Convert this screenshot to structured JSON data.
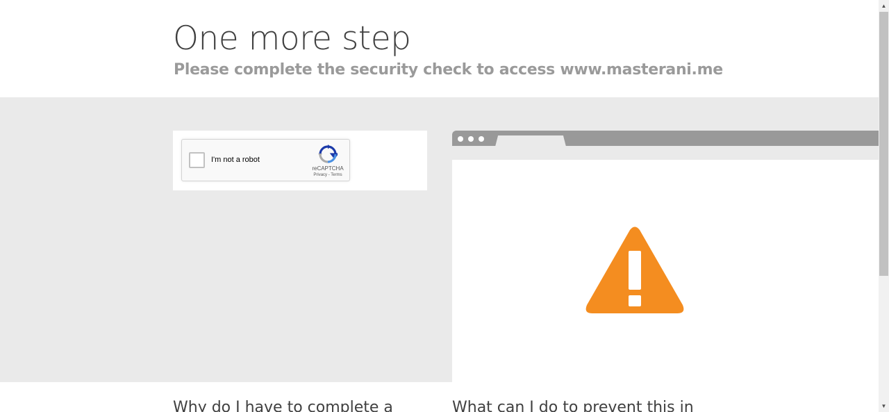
{
  "header": {
    "title": "One more step",
    "subtitle": "Please complete the security check to access www.masterani.me"
  },
  "recaptcha": {
    "label": "I'm not a robot",
    "brand": "reCAPTCHA",
    "links": "Privacy - Terms",
    "checked": false
  },
  "browser_illustration": {
    "icon": "warning-triangle-icon",
    "icon_color": "#f48d20"
  },
  "sections": {
    "why_heading": "Why do I have to complete a",
    "prevent_heading": "What can I do to prevent this in"
  },
  "colors": {
    "background_band": "#eaeaea",
    "title_text": "#404040",
    "subtitle_text": "#9a9a9a",
    "browser_bar": "#999999",
    "warning": "#f48d20"
  }
}
